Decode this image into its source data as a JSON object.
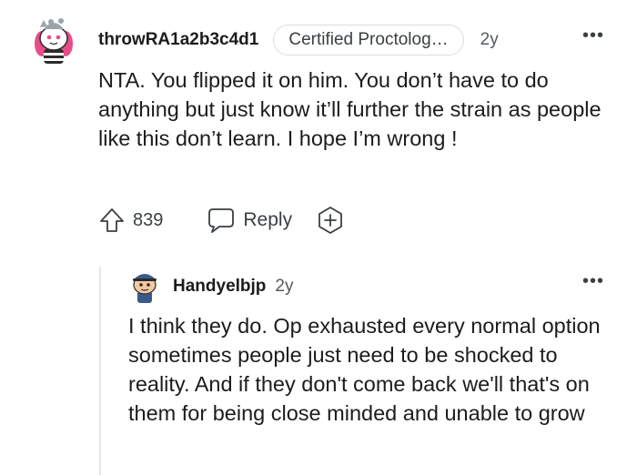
{
  "comment": {
    "username": "throwRA1a2b3c4d1",
    "flair": "Certified Proctolog…",
    "age": "2y",
    "more": "•••",
    "body": "NTA. You flipped it on him. You don’t have to do anything but just know it’ll further the strain as people like this don’t learn. I hope I’m wrong !",
    "votes": "839",
    "reply_label": "Reply",
    "avatar_icon": "snoo-avatar-icon",
    "upvote_icon": "upvote-arrow-icon",
    "reply_icon": "speech-bubble-icon",
    "award_icon": "add-award-icon"
  },
  "reply": {
    "username": "Handyelbjp",
    "age": "2y",
    "more": "•••",
    "body": "I think they do. Op exhausted every normal option sometimes people just need to be shocked to reality. And if they don't come back we'll that's on them for being close minded and unable to grow",
    "avatar_icon": "snoo-avatar-icon"
  },
  "colors": {
    "text": "#1c1c1c",
    "muted": "#555a5e",
    "border": "#d8dde0",
    "thread_line": "#e5e8ea",
    "avatar1_hair": "#e84d8a",
    "avatar2_cap": "#3a5a8c"
  }
}
